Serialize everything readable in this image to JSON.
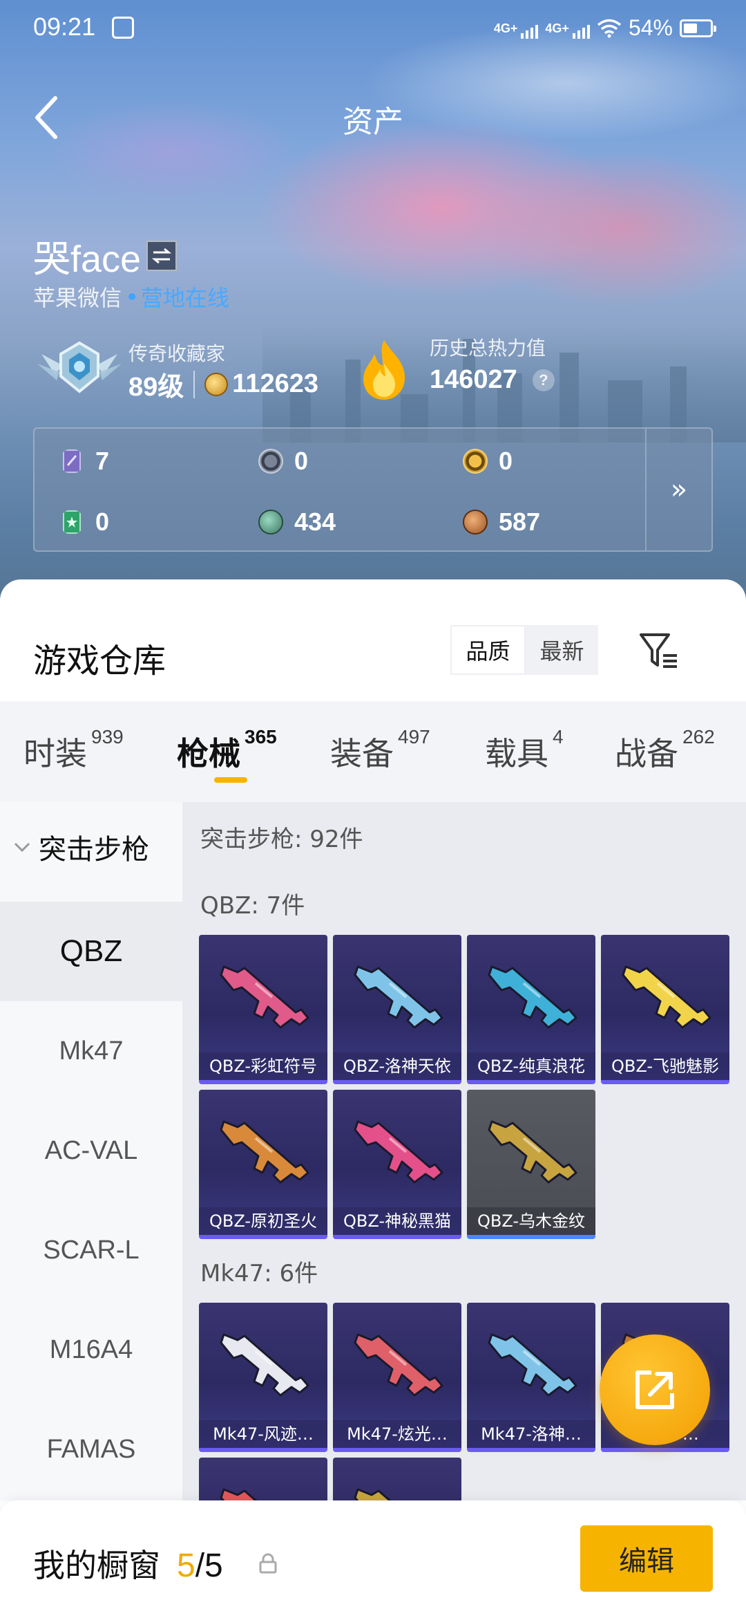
{
  "status_bar": {
    "time": "09:21",
    "signal1": "4G+",
    "signal2": "4G+",
    "battery_percent": "54%",
    "battery_level": 0.54
  },
  "header": {
    "title": "资产"
  },
  "profile": {
    "name": "哭face",
    "platform": "苹果微信",
    "online_status": "营地在线",
    "rank_title": "传奇收藏家",
    "level": "89级",
    "coins": "112623",
    "heat_title": "历史总热力值",
    "heat_value": "146027",
    "help": "?"
  },
  "currencies": [
    {
      "name": "purple-card",
      "value": "7",
      "color": "#7c6cc4"
    },
    {
      "name": "silver-coin",
      "value": "0",
      "color": "#8c96a8"
    },
    {
      "name": "gold-coin",
      "value": "0",
      "color": "#d8a32a"
    },
    {
      "name": "green-card",
      "value": "0",
      "color": "#2ea36a"
    },
    {
      "name": "green-orb",
      "value": "434",
      "color": "#5aa08c"
    },
    {
      "name": "bronze-coin",
      "value": "587",
      "color": "#c07a3a"
    }
  ],
  "currency_expand": "»",
  "warehouse": {
    "title": "游戏仓库",
    "sort_options": [
      "品质",
      "最新"
    ],
    "tabs": [
      {
        "label": "时装",
        "count": "939"
      },
      {
        "label": "枪械",
        "count": "365"
      },
      {
        "label": "装备",
        "count": "497"
      },
      {
        "label": "载具",
        "count": "4"
      },
      {
        "label": "战备",
        "count": "262"
      }
    ],
    "category_header": "突击步枪",
    "categories": [
      "QBZ",
      "Mk47",
      "AC-VAL",
      "SCAR-L",
      "M16A4",
      "FAMAS"
    ],
    "summary": "突击步枪: 92件",
    "groups": [
      {
        "title": "QBZ: 7件",
        "items": [
          {
            "label": "QBZ-彩虹符号",
            "color": "#e05a8a"
          },
          {
            "label": "QBZ-洛神天依",
            "color": "#7fc4e8"
          },
          {
            "label": "QBZ-纯真浪花",
            "color": "#3fb0d8"
          },
          {
            "label": "QBZ-飞驰魅影",
            "color": "#f2d44a"
          },
          {
            "label": "QBZ-原初圣火",
            "color": "#d88a3a"
          },
          {
            "label": "QBZ-神秘黑猫",
            "color": "#e4508a"
          },
          {
            "label": "QBZ-乌木金纹",
            "color": "#c8a440"
          }
        ]
      },
      {
        "title": "Mk47: 6件",
        "items": [
          {
            "label": "Mk47-风迹…",
            "color": "#e8e8f0"
          },
          {
            "label": "Mk47-炫光…",
            "color": "#e0606a"
          },
          {
            "label": "Mk47-洛神…",
            "color": "#7fc4e8"
          },
          {
            "label": "Mk47-…",
            "color": "#c07a3a"
          },
          {
            "label": "",
            "color": "#e05a5a"
          },
          {
            "label": "",
            "color": "#c8a440"
          }
        ]
      }
    ]
  },
  "showcase": {
    "label": "我的橱窗",
    "current": "5",
    "total": "/5",
    "edit_label": "编辑"
  }
}
